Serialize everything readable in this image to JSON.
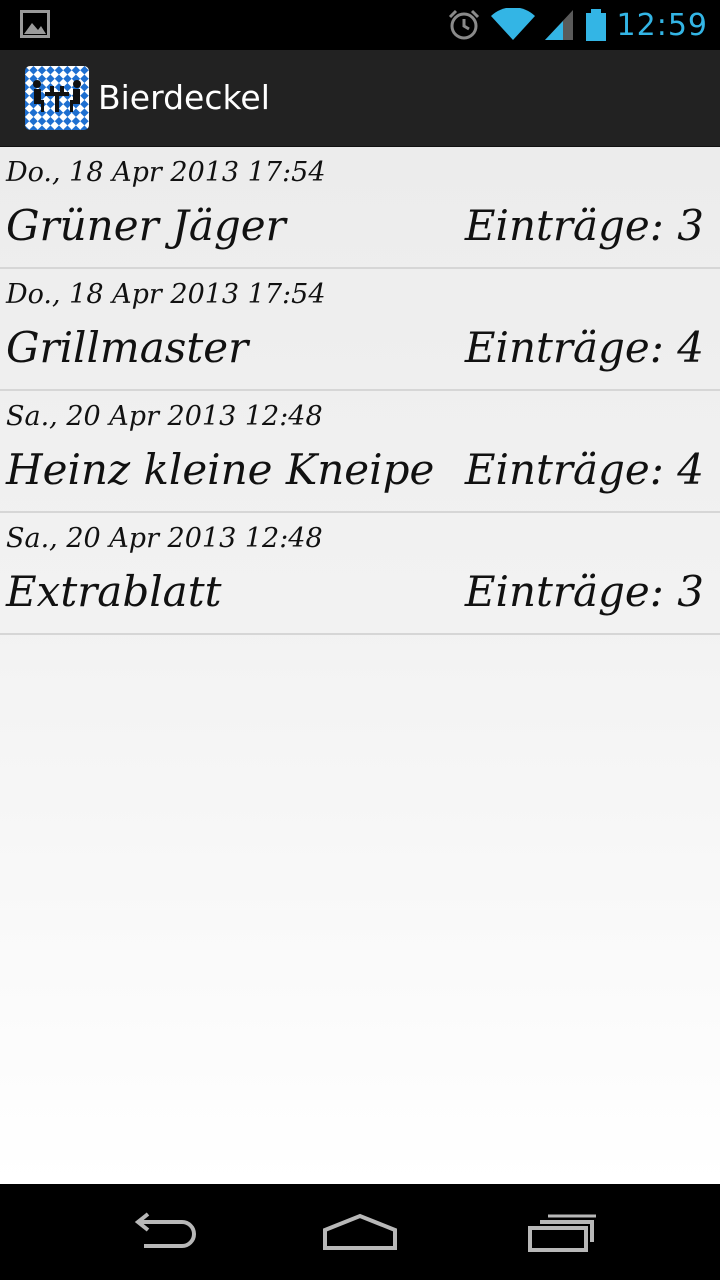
{
  "status_bar": {
    "time": "12:59",
    "icons": [
      "image-notification-icon",
      "alarm-icon",
      "wifi-icon",
      "cell-signal-icon",
      "battery-icon"
    ],
    "accent_color": "#33b5e5"
  },
  "action_bar": {
    "title": "Bierdeckel",
    "icon": "app-logo-icon"
  },
  "list": {
    "items": [
      {
        "date": "Do., 18 Apr 2013 17:54",
        "name": "Grüner Jäger",
        "count": "Einträge: 3"
      },
      {
        "date": "Do., 18 Apr 2013 17:54",
        "name": "Grillmaster",
        "count": "Einträge: 4"
      },
      {
        "date": "Sa., 20 Apr 2013 12:48",
        "name": "Heinz kleine Kneipe",
        "count": "Einträge: 4"
      },
      {
        "date": "Sa., 20 Apr 2013 12:48",
        "name": "Extrablatt",
        "count": "Einträge: 3"
      }
    ]
  },
  "nav_bar": {
    "icons": [
      "back-icon",
      "home-icon",
      "recent-apps-icon"
    ]
  }
}
